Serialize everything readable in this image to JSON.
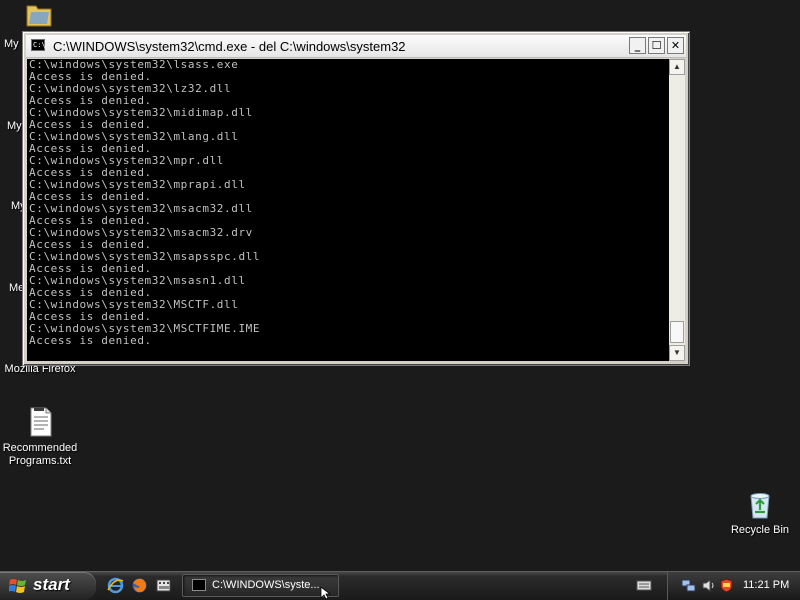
{
  "desktop": {
    "partial_labels": [
      "My",
      "My",
      "My",
      "Me"
    ],
    "icons": [
      {
        "name": "mozilla-firefox",
        "label": "Mozilla Firefox"
      },
      {
        "name": "recommended-programs",
        "label": "Recommended Programs.txt"
      },
      {
        "name": "recycle-bin",
        "label": "Recycle Bin"
      }
    ]
  },
  "cmd_window": {
    "title": "C:\\WINDOWS\\system32\\cmd.exe - del C:\\windows\\system32",
    "icon_glyph": "C:\\",
    "buttons": {
      "minimize": "_",
      "maximize": "☐",
      "close": "✕"
    },
    "lines": [
      "C:\\windows\\system32\\lsass.exe",
      "Access is denied.",
      "C:\\windows\\system32\\lz32.dll",
      "Access is denied.",
      "C:\\windows\\system32\\midimap.dll",
      "Access is denied.",
      "C:\\windows\\system32\\mlang.dll",
      "Access is denied.",
      "C:\\windows\\system32\\mpr.dll",
      "Access is denied.",
      "C:\\windows\\system32\\mprapi.dll",
      "Access is denied.",
      "C:\\windows\\system32\\msacm32.dll",
      "Access is denied.",
      "C:\\windows\\system32\\msacm32.drv",
      "Access is denied.",
      "C:\\windows\\system32\\msapsspc.dll",
      "Access is denied.",
      "C:\\windows\\system32\\msasn1.dll",
      "Access is denied.",
      "C:\\windows\\system32\\MSCTF.dll",
      "Access is denied.",
      "C:\\windows\\system32\\MSCTFIME.IME",
      "Access is denied."
    ],
    "text_color": "#c0c0c0",
    "background_color": "#000000"
  },
  "taskbar": {
    "start_label": "start",
    "task_button_label": "C:\\WINDOWS\\syste...",
    "clock": "11:21 PM",
    "quick_launch": [
      "ie-icon",
      "firefox-icon",
      "media-icon"
    ],
    "tray": [
      "network-icon",
      "volume-icon",
      "security-icon"
    ]
  }
}
